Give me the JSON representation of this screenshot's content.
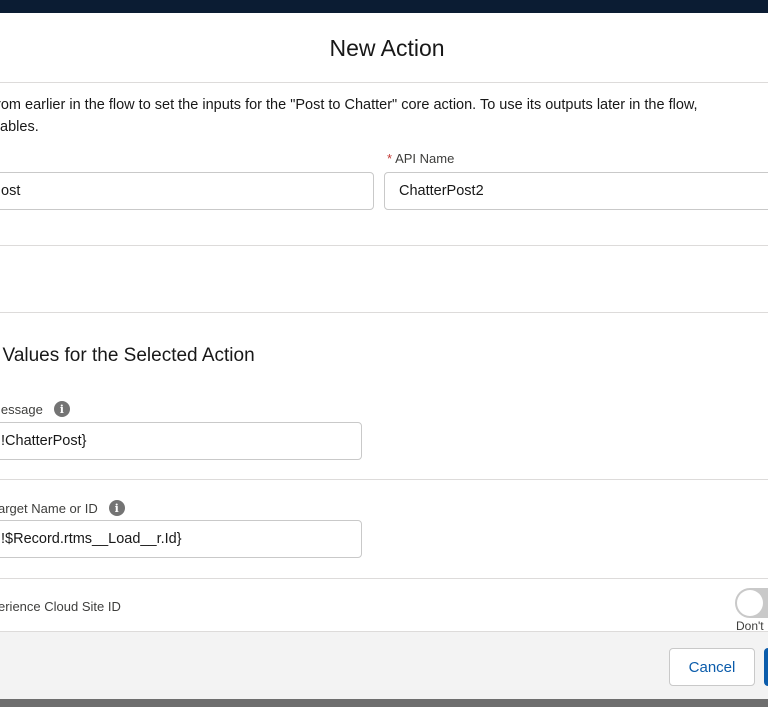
{
  "modal": {
    "title": "New Action"
  },
  "description": {
    "line1": " from earlier in the flow to set the inputs for the \"Post to Chatter\" core action. To use its outputs later in the flow,",
    "line2": "riables."
  },
  "fields": {
    "label_value": "ost",
    "api_name_label": "API Name",
    "api_name_required_mark": "*",
    "api_name_value": "ChatterPost2"
  },
  "section": {
    "title": "t Values for the Selected Action"
  },
  "inputs": {
    "message_label": "lessage",
    "message_value": "!ChatterPost}",
    "target_label": "arget Name or ID",
    "target_value": "!$Record.rtms__Load__r.Id}",
    "experience_label": "erience Cloud Site ID",
    "experience_toggle_text": "Don't"
  },
  "footer": {
    "cancel_label": "Cancel"
  },
  "colors": {
    "brand": "#0b5cab",
    "topbar": "#0b1c33",
    "required": "#c23934"
  },
  "icons": {
    "info": "info-icon"
  }
}
